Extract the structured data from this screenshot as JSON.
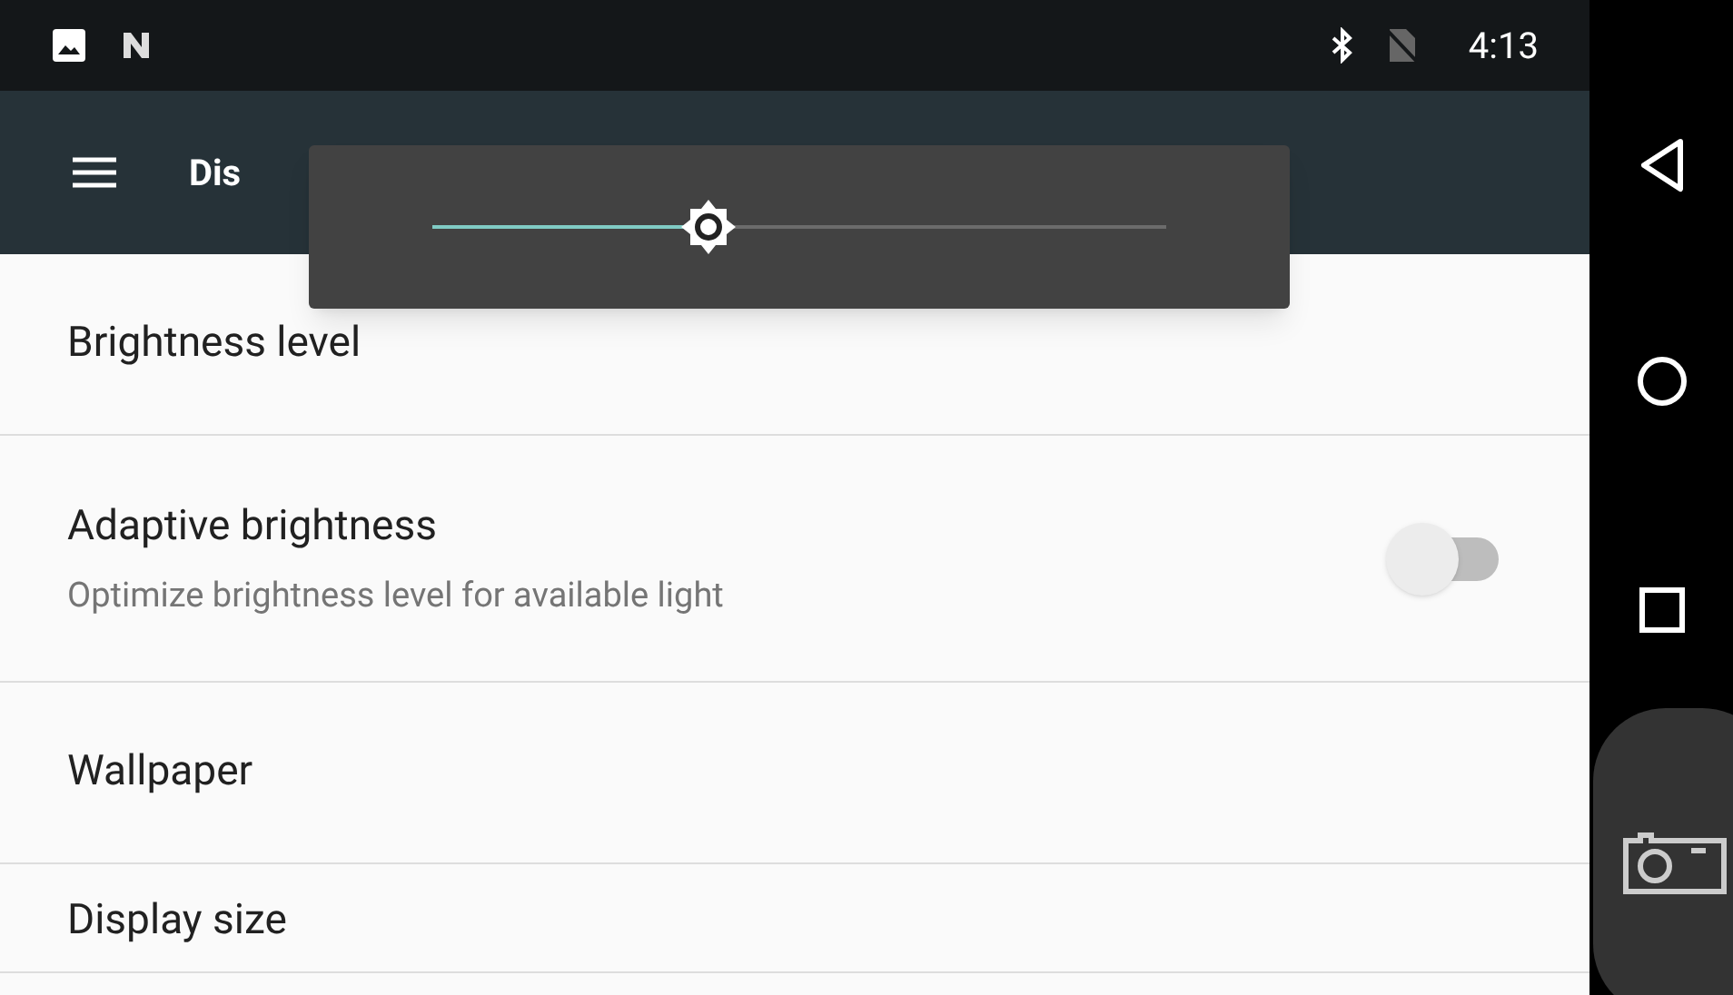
{
  "status_bar": {
    "time": "4:13"
  },
  "toolbar": {
    "title": "Dis"
  },
  "brightness_popup": {
    "level": 0.376
  },
  "settings": [
    {
      "kind": "plain",
      "title": "Brightness level"
    },
    {
      "kind": "switch",
      "title": "Adaptive brightness",
      "summary": "Optimize brightness level for available light",
      "on": false
    },
    {
      "kind": "plain",
      "title": "Wallpaper"
    },
    {
      "kind": "plain",
      "title": "Display size"
    }
  ]
}
